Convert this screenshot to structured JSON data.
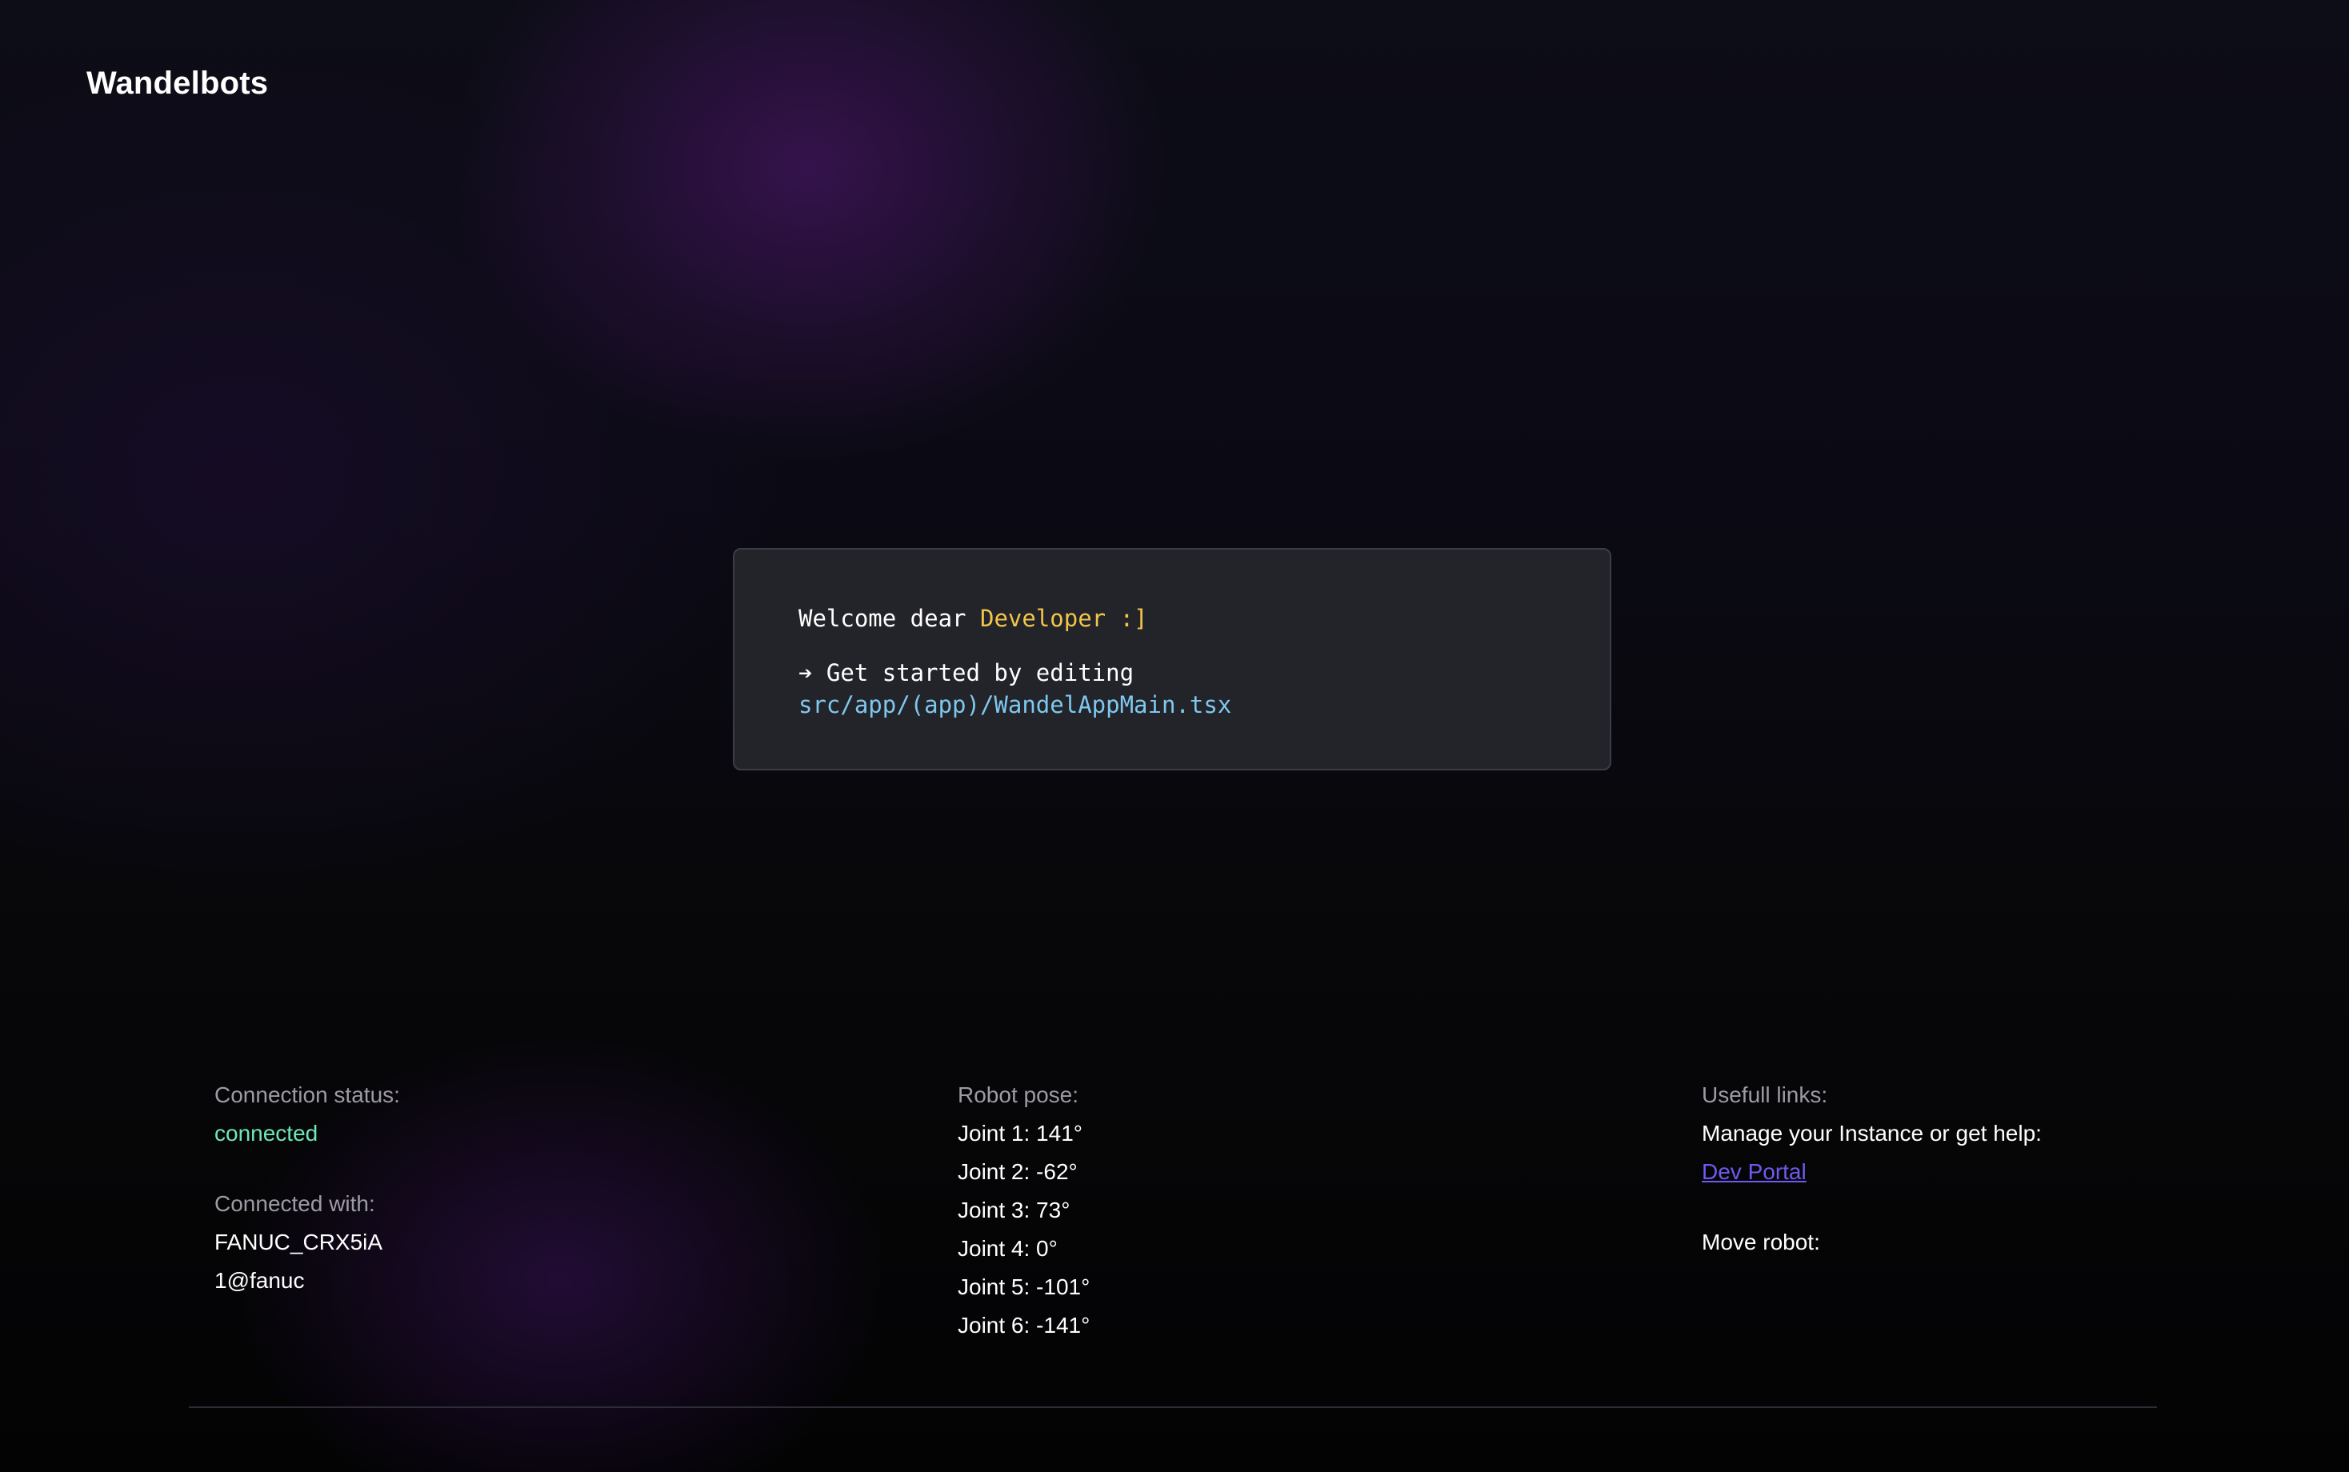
{
  "header": {
    "logo_text": "Wandelbots"
  },
  "welcome": {
    "greeting_prefix": "Welcome dear ",
    "greeting_name": "Developer :]",
    "instruction": "➔ Get started by editing",
    "file_path": "src/app/(app)/WandelAppMain.tsx"
  },
  "connection": {
    "status_label": "Connection status:",
    "status_value": "connected",
    "with_label": "Connected with:",
    "with_line_1": "FANUC_CRX5iA",
    "with_line_2": "1@fanuc"
  },
  "robot_pose": {
    "label": "Robot pose:",
    "joints": [
      "Joint 1: 141°",
      "Joint 2: -62°",
      "Joint 3: 73°",
      "Joint 4: 0°",
      "Joint 5: -101°",
      "Joint 6: -141°"
    ]
  },
  "links": {
    "label": "Usefull links:",
    "manage_text": "Manage your Instance or get help:",
    "dev_portal": "Dev Portal",
    "move_robot": "Move robot:"
  },
  "colors": {
    "status_connected": "#6ee7b7",
    "accent_yellow": "#f0c54a",
    "accent_blue": "#7ec8ee",
    "link": "#6d5bf0"
  }
}
